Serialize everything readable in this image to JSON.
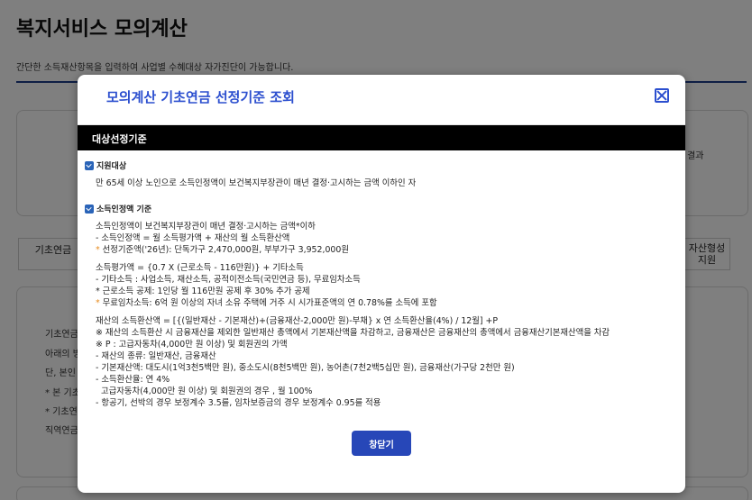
{
  "background": {
    "title": "복지서비스 모의계산",
    "description": "간단한 소득재산항목을 입력하여 사업별 수혜대상 자가진단이 가능합니다.",
    "card_right_text": "결과",
    "tab_basic_pension": "기초연금",
    "tab_asset_formation": "자산형성\n지원",
    "content_lines": [
      "기초연금",
      "아래의 방",
      "단, 본인",
      "* 본 기초",
      "* 기초연",
      "직역연금"
    ]
  },
  "modal": {
    "title": "모의계산 기초연금 선정기준 조회",
    "section_title": "대상선정기준",
    "support_target": {
      "heading": "지원대상",
      "text": "만 65세 이상 노인으로 소득인정액이 보건복지부장관이 매년 결정·고시하는 금액 이하인 자"
    },
    "income_standard": {
      "heading": "소득인정액 기준",
      "block1": [
        "소득인정액이 보건복지부장관이 매년 결정·고시하는 금액*이하",
        "- 소득인정액 = 월 소득평가액 + 재산의 월 소득환산액",
        "선정기준액('26년): 단독가구 2,470,000원, 부부가구 3,952,000원"
      ],
      "block2": [
        "소득평가액 = {0.7 X (근로소득 - 116만원)} + 기타소득",
        "- 기타소득 : 사업소득, 재산소득, 공적이전소득(국민연금 등), 무료임차소득",
        "* 근로소득 공제: 1인당 월 116만원 공제 후 30% 추가 공제",
        "무료임차소득: 6억 원 이상의 자녀 소유 주택에 거주 시 시가표준액의 연 0.78%를 소득에 포함"
      ],
      "block3": [
        "재산의 소득환산액 = [{(일반재산 - 기본재산)+(금융재산-2,000만 원)-부채} x 연 소득환산율(4%) / 12월] +P",
        "※ 재산의 소득환산 시 금융재산을 제외한 일반재산 총액에서 기본재산액을 차감하고, 금융재산은 금융재산의 총액에서 금융재산기본재산액을 차감",
        "※ P : 고급자동차(4,000만 원 이상) 및 회원권의 가액",
        "- 재산의 종류: 일반재산, 금융재산",
        "- 기본재산액: 대도시(1억3천5백만 원), 중소도시(8천5백만 원), 농어촌(7천2백5십만 원), 금융재산(가구당 2천만 원)",
        "- 소득환산율: 연 4%",
        "고급자동차(4,000만 원 이상) 및 회원권의 경우 , 월 100%",
        "- 항공기, 선박의 경우 보정계수 3.5를, 임차보증금의 경우 보정계수 0.95를 적용"
      ],
      "star_marker": "*"
    },
    "close_button_label": "창닫기"
  },
  "icons": [
    "close-icon",
    "section-bullet-icon"
  ],
  "colors": {
    "accent": "#2c4fcf",
    "button": "#2747b8",
    "section_bar": "#000000",
    "star": "#e88c20"
  }
}
